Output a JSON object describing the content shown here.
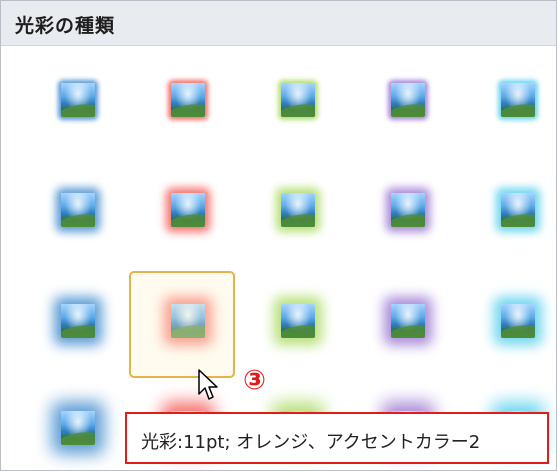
{
  "header": {
    "title": "光彩の種類"
  },
  "grid": {
    "rows": [
      [
        "glow-blue-small",
        "glow-red-small",
        "glow-green-small",
        "glow-purple-small",
        "glow-cyan-small"
      ],
      [
        "glow-blue-medium",
        "glow-red-medium",
        "glow-green-medium",
        "glow-purple-medium",
        "glow-cyan-medium"
      ],
      [
        "glow-blue-large",
        "glow-red-large",
        "glow-green-large",
        "glow-purple-large",
        "glow-cyan-large"
      ],
      [
        "glow-blue-xlarge",
        "glow-red-xlarge",
        "glow-green-xlarge",
        "glow-purple-xlarge",
        "glow-cyan-xlarge"
      ]
    ],
    "colors": {
      "blue": "#5b9bd5",
      "red": "#f4736e",
      "green": "#b7e07a",
      "purple": "#a98bd8",
      "cyan": "#6fd6ef"
    },
    "selected": {
      "row": 3,
      "col": 2
    }
  },
  "annotation": {
    "marker": "③"
  },
  "tooltip": {
    "text": "光彩:11pt; オレンジ、アクセントカラー2"
  },
  "accent": {
    "selection": "#e4b34a",
    "highlight_border": "#e01c1c"
  }
}
